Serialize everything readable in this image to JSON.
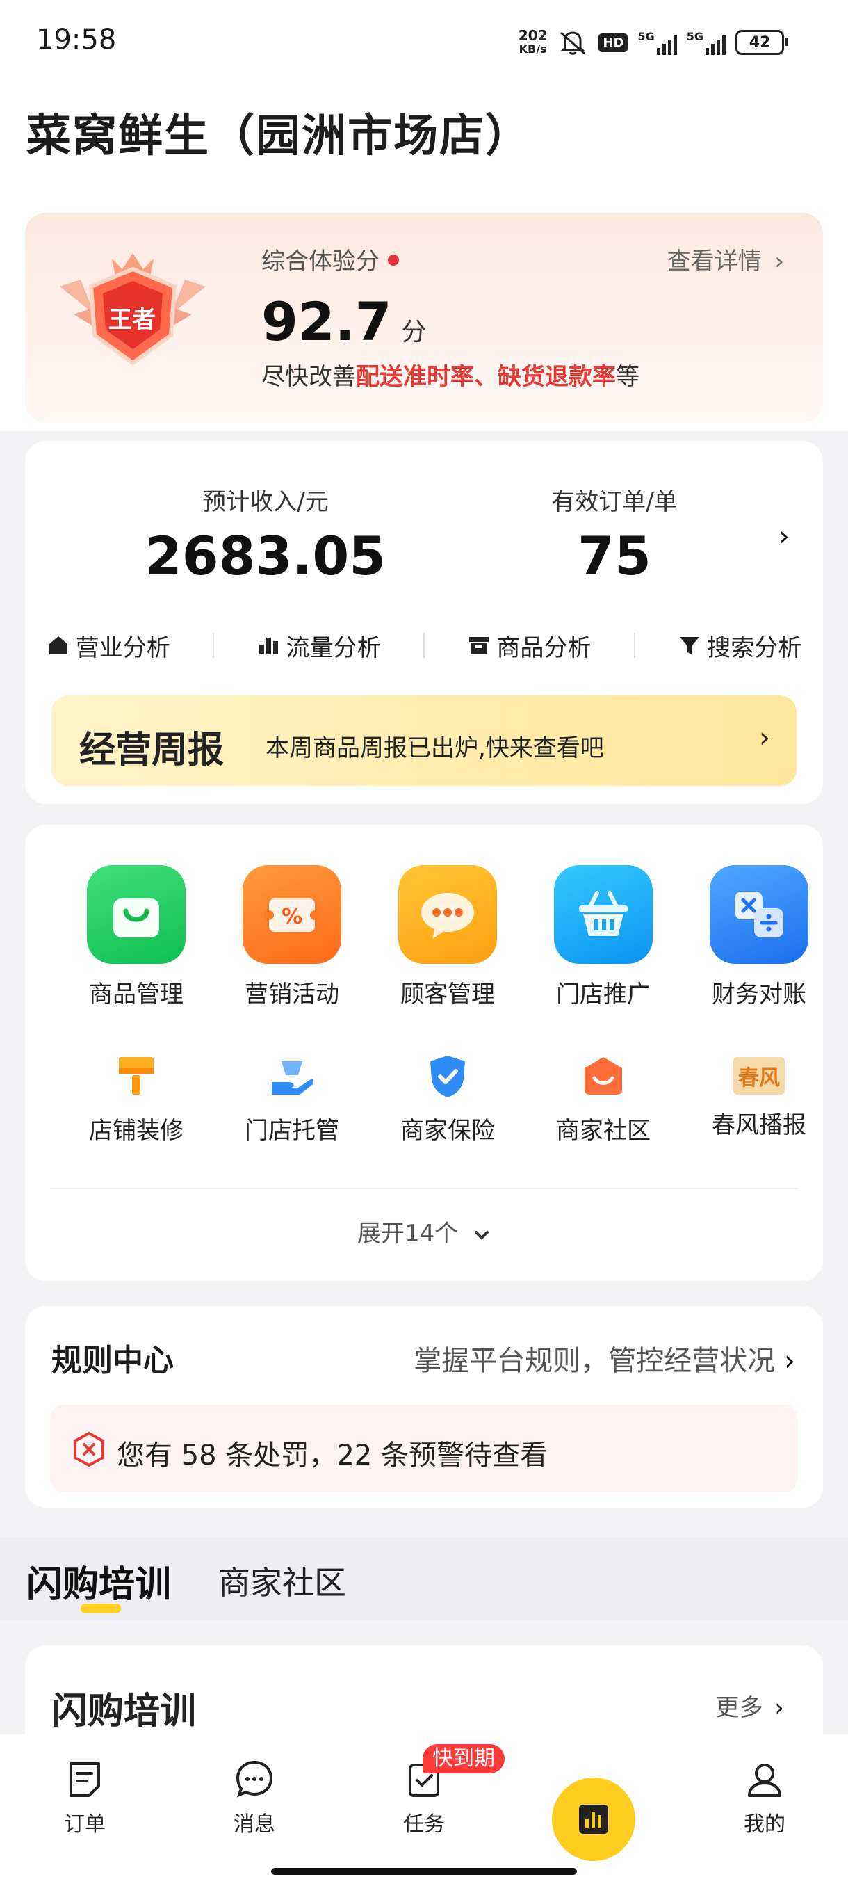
{
  "status_bar": {
    "time": "19:58",
    "net_speed_value": "202",
    "net_speed_unit": "KB/s",
    "hd_label": "HD",
    "signal_1_label": "5G",
    "signal_2_label": "5G",
    "battery": "42"
  },
  "store": {
    "name": "菜窝鲜生（园洲市场店）"
  },
  "score_card": {
    "badge_text": "王者",
    "label": "综合体验分",
    "detail_link": "查看详情",
    "score": "92.7",
    "unit": "分",
    "tip_prefix": "尽快改善",
    "tip_highlight": "配送准时率、缺货退款率",
    "tip_suffix": "等"
  },
  "revenue": {
    "income_label": "预计收入/元",
    "income_value": "2683.05",
    "orders_label": "有效订单/单",
    "orders_value": "75"
  },
  "analysis": [
    {
      "label": "营业分析",
      "icon": "home-icon"
    },
    {
      "label": "流量分析",
      "icon": "bar-chart-icon"
    },
    {
      "label": "商品分析",
      "icon": "box-icon"
    },
    {
      "label": "搜索分析",
      "icon": "funnel-icon"
    }
  ],
  "weekly_report": {
    "title": "经营周报",
    "subtitle": "本周商品周报已出炉,快来查看吧"
  },
  "tools": {
    "row1": [
      {
        "label": "商品管理",
        "icon": "shopping-bag-icon"
      },
      {
        "label": "营销活动",
        "icon": "coupon-icon"
      },
      {
        "label": "顾客管理",
        "icon": "chat-stars-icon"
      },
      {
        "label": "门店推广",
        "icon": "basket-icon"
      },
      {
        "label": "财务对账",
        "icon": "calculator-icon"
      }
    ],
    "row2": [
      {
        "label": "店铺装修",
        "icon": "paint-brush-icon"
      },
      {
        "label": "门店托管",
        "icon": "hand-icon"
      },
      {
        "label": "商家保险",
        "icon": "shield-icon"
      },
      {
        "label": "商家社区",
        "icon": "community-icon"
      },
      {
        "label": "春风播报",
        "icon": "spring-news-icon"
      }
    ],
    "spring_icon_text": "春风",
    "expand_label": "展开14个"
  },
  "rules": {
    "title": "规则中心",
    "link": "掌握平台规则，管控经营状况",
    "alert": "您有 58 条处罚，22 条预警待查看"
  },
  "training_tabs": {
    "active": "闪购培训",
    "inactive": "商家社区"
  },
  "training": {
    "title": "闪购培训",
    "more": "更多"
  },
  "bottom_nav": {
    "items": [
      {
        "label": "订单",
        "icon": "order-icon"
      },
      {
        "label": "消息",
        "icon": "message-icon"
      },
      {
        "label": "任务",
        "icon": "task-icon"
      },
      {
        "label": "我的",
        "icon": "profile-icon"
      }
    ],
    "task_badge": "快到期",
    "center_icon": "dashboard-icon"
  },
  "colors": {
    "accent_yellow": "#ffcc1f",
    "alert_red": "#e53935"
  }
}
